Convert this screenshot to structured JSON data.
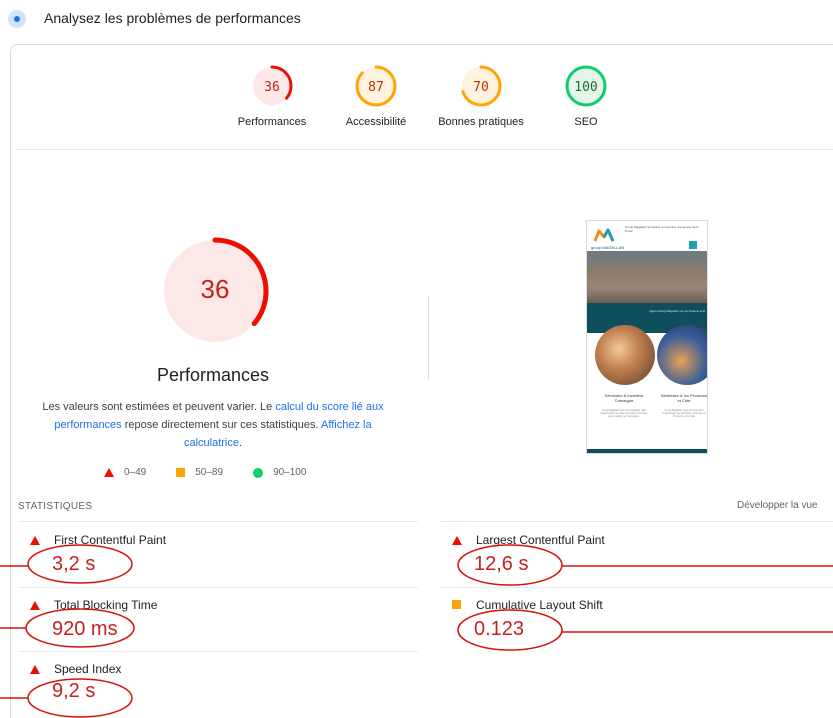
{
  "header": {
    "title": "Analysez les problèmes de performances"
  },
  "categories": [
    {
      "label": "Performances",
      "score": "36",
      "color": "#eb0f00",
      "bg": "#fce8e6",
      "fraction": 0.36
    },
    {
      "label": "Accessibilité",
      "score": "87",
      "color": "#ffa400",
      "bg": "#fff3e0",
      "fraction": 0.87
    },
    {
      "label": "Bonnes pratiques",
      "score": "70",
      "color": "#ffa400",
      "bg": "#fff3e0",
      "fraction": 0.7
    },
    {
      "label": "SEO",
      "score": "100",
      "color": "#0cce6b",
      "bg": "#e6f4ea",
      "fraction": 1.0
    }
  ],
  "main_gauge": {
    "score": "36",
    "title": "Performances",
    "color": "#eb0f00",
    "bg": "#fce8e6",
    "fraction": 0.36
  },
  "description": {
    "part1": "Les valeurs sont estimées et peuvent varier. Le ",
    "link1": "calcul du score lié aux performances",
    "part2": " repose directement sur ces statistiques. ",
    "link2": "Affichez la calculatrice",
    "part3": "."
  },
  "legend": {
    "poor": "0–49",
    "average": "50–89",
    "good": "90–100"
  },
  "thumbnail": {
    "brand": "group MAGELLAN",
    "nav": "Group Magellan   Séminaire & Incentive Camargue   Sémi Prove",
    "band_text": "Agen Group Magellan voy en France et al",
    "card1_title": "Séminaire & Incentive Camargue",
    "card2_title": "Séminaire & Inc Provence et Côte",
    "card1_text": "Group Magellan vous accompagne dans l'organisation de votre séminaire, incentive, team building en Camargue.",
    "card2_text": "Group Magellan vous accomp dans l'organisation de séminaire, incentive en Provence et la Côte"
  },
  "stats": {
    "label": "STATISTIQUES",
    "expand": "Développer la vue",
    "metrics": [
      {
        "name": "First Contentful Paint",
        "value": "3,2 s",
        "status": "poor"
      },
      {
        "name": "Largest Contentful Paint",
        "value": "12,6 s",
        "status": "poor"
      },
      {
        "name": "Total Blocking Time",
        "value": "920 ms",
        "status": "poor"
      },
      {
        "name": "Cumulative Layout Shift",
        "value": "0.123",
        "status": "average"
      },
      {
        "name": "Speed Index",
        "value": "9,2 s",
        "status": "poor"
      }
    ]
  },
  "colors": {
    "poor": "#eb0f00",
    "average": "#ffa400",
    "good": "#0cce6b",
    "annotation": "#d9120b",
    "link": "#1a73e8"
  }
}
